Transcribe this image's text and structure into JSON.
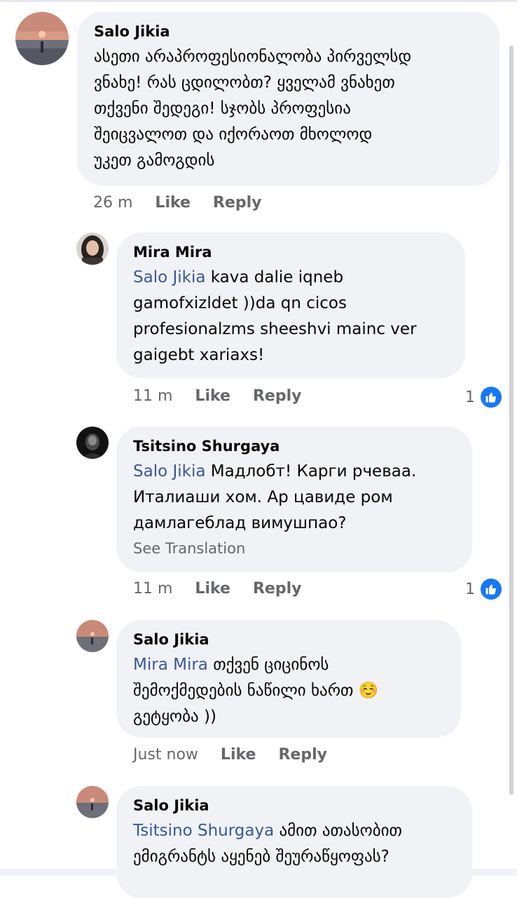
{
  "comments": [
    {
      "author": "Salo Jikia",
      "mention": "",
      "text": "ასეთი არაპროფესიონალობა პირველსდ\nვნახე! რას ცდილობთ? ყველამ ვნახეთ\nთქვენი შედეგი! სჯობს პროფესია\nშეიცვალოთ და იქორაოთ მხოლოდ\nუკეთ გამოგდის",
      "time": "26 m",
      "like_label": "Like",
      "reply_label": "Reply",
      "reaction_count": ""
    },
    {
      "author": "Mira Mira",
      "mention": "Salo Jikia",
      "text": " kava dalie iqneb\ngamofxizldet ))da qn cicos\nprofesionalzms sheeshvi mainc ver\ngaigebt xariaxs!",
      "time": "11 m",
      "like_label": "Like",
      "reply_label": "Reply",
      "reaction_count": "1"
    },
    {
      "author": "Tsitsino Shurgaya",
      "mention": "Salo Jikia",
      "text": "  Мадлобт! Карги рчеваа.\nИталиаши хом. Ар цавиде ром\nдамлагеблад вимушпао?",
      "see_translation": "See Translation",
      "time": "11 m",
      "like_label": "Like",
      "reply_label": "Reply",
      "reaction_count": "1"
    },
    {
      "author": "Salo Jikia",
      "mention": "Mira Mira",
      "text": " თქვენ ციცინოს\nშემოქმედების ნაწილი ხართ ☺️\nგეტყობა ))",
      "time": "Just now",
      "like_label": "Like",
      "reply_label": "Reply",
      "reaction_count": ""
    },
    {
      "author": "Salo Jikia",
      "mention": "Tsitsino Shurgaya",
      "text": " ამით ათასობით\nემიგრანტს აყენებ შეურაწყოფას?",
      "time": "",
      "like_label": "",
      "reply_label": "",
      "reaction_count": ""
    }
  ],
  "colors": {
    "bubble": "#f0f2f5",
    "mention": "#385898",
    "meta": "#65676b",
    "like_badge": "#1877f2"
  },
  "icons": {
    "reaction": "thumbs-up-icon"
  }
}
